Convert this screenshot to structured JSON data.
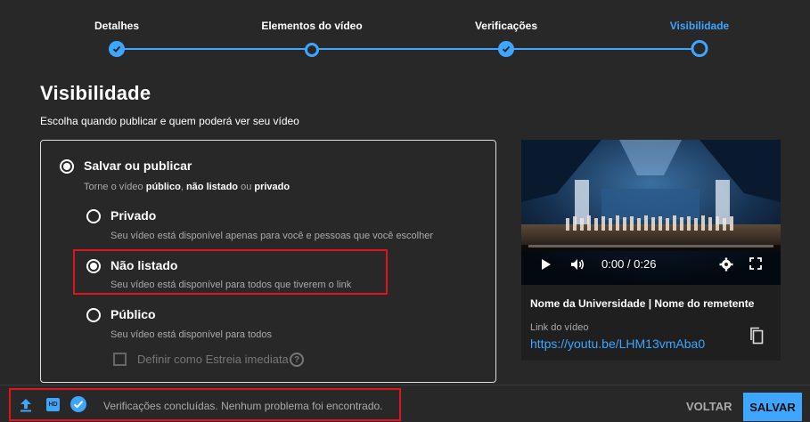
{
  "stepper": {
    "steps": [
      {
        "label": "Detalhes",
        "state": "done"
      },
      {
        "label": "Elementos do vídeo",
        "state": "current-visited"
      },
      {
        "label": "Verificações",
        "state": "done"
      },
      {
        "label": "Visibilidade",
        "state": "active"
      }
    ]
  },
  "page": {
    "title": "Visibilidade",
    "subtitle": "Escolha quando publicar e quem poderá ver seu vídeo"
  },
  "save_publish": {
    "label": "Salvar ou publicar",
    "desc_prefix": "Torne o vídeo ",
    "desc_public": "público",
    "desc_sep": ", ",
    "desc_unlisted": "não listado",
    "desc_or": " ou ",
    "desc_private": "privado",
    "selected": true
  },
  "options": [
    {
      "label": "Privado",
      "desc": "Seu vídeo está disponível apenas para você e pessoas que você escolher",
      "selected": false
    },
    {
      "label": "Não listado",
      "desc": "Seu vídeo está disponível para todos que tiverem o link",
      "selected": true
    },
    {
      "label": "Público",
      "desc": "Seu vídeo está disponível para todos",
      "selected": false
    }
  ],
  "premiere": {
    "label": "Definir como Estreia imediata",
    "checked": false,
    "disabled": true
  },
  "video_card": {
    "time": "0:00 / 0:26",
    "title": "Nome da Universidade | Nome do remetente",
    "link_label": "Link do vídeo",
    "link": "https://youtu.be/LHM13vmAba0"
  },
  "footer": {
    "status": "Verificações concluídas. Nenhum problema foi encontrado.",
    "hd_badge": "HD",
    "back_label": "VOLTAR",
    "save_label": "SALVAR"
  },
  "colors": {
    "accent": "#3ea6ff",
    "highlight": "#e0141e",
    "background": "#282828"
  },
  "icons": [
    "check-icon",
    "upload-icon",
    "hd-icon",
    "check-circle-icon",
    "play-icon",
    "volume-icon",
    "settings-icon",
    "fullscreen-icon",
    "copy-icon",
    "help-icon"
  ]
}
